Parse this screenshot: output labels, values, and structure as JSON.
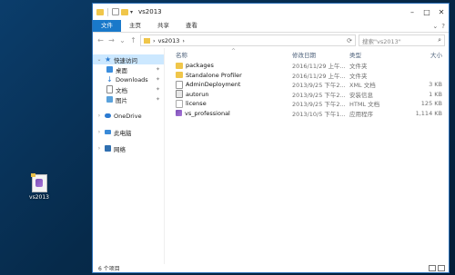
{
  "desktop": {
    "icon_label": "vs2013"
  },
  "window": {
    "title": "vs2013",
    "ribbon": {
      "tabs": [
        "文件",
        "主页",
        "共享",
        "查看"
      ]
    },
    "address": {
      "path": "vs2013",
      "search_placeholder": "搜索\"vs2013\""
    },
    "sidebar": [
      {
        "label": "快速访问",
        "icon": "star-icon"
      },
      {
        "label": "桌面",
        "icon": "desktop-icon"
      },
      {
        "label": "Downloads",
        "icon": "download-icon"
      },
      {
        "label": "文档",
        "icon": "document-icon"
      },
      {
        "label": "图片",
        "icon": "picture-icon"
      },
      {
        "label": "OneDrive",
        "icon": "cloud-icon"
      },
      {
        "label": "此电脑",
        "icon": "computer-icon"
      },
      {
        "label": "网络",
        "icon": "network-icon"
      }
    ],
    "columns": {
      "name": "名称",
      "date": "修改日期",
      "type": "类型",
      "size": "大小"
    },
    "files": [
      {
        "name": "packages",
        "date": "2016/11/29 上午...",
        "type": "文件夹",
        "size": "",
        "icon": "folder-icon"
      },
      {
        "name": "Standalone Profiler",
        "date": "2016/11/29 上午...",
        "type": "文件夹",
        "size": "",
        "icon": "folder-icon"
      },
      {
        "name": "AdminDeployment",
        "date": "2013/9/25 下午2...",
        "type": "XML 文档",
        "size": "3 KB",
        "icon": "xml-file-icon"
      },
      {
        "name": "autorun",
        "date": "2013/9/25 下午2...",
        "type": "安装信息",
        "size": "1 KB",
        "icon": "setup-info-icon"
      },
      {
        "name": "license",
        "date": "2013/9/25 下午2...",
        "type": "HTML 文档",
        "size": "125 KB",
        "icon": "html-file-icon"
      },
      {
        "name": "vs_professional",
        "date": "2013/10/5 下午1...",
        "type": "应用程序",
        "size": "1,114 KB",
        "icon": "app-icon"
      }
    ],
    "status": {
      "count": "6 个项目"
    }
  },
  "watermark": {
    "text": "Bai 经验",
    "sub": "jingyan.baidu.com"
  }
}
